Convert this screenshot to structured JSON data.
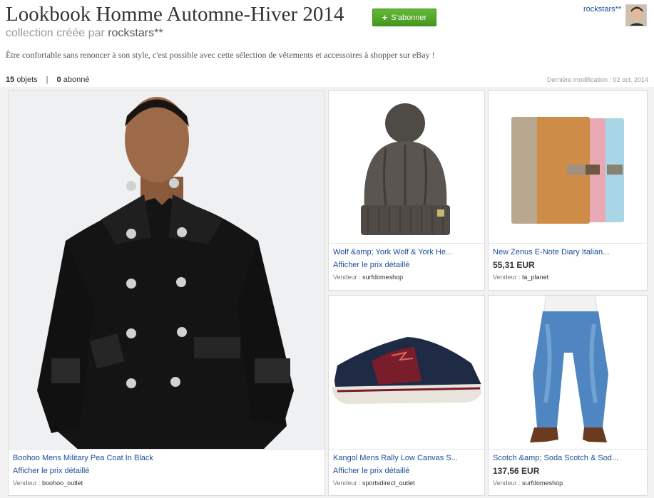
{
  "header": {
    "title": "Lookbook Homme Automne-Hiver 2014",
    "subscribe_label": "S'abonner",
    "byline_prefix": "collection créée par",
    "owner": "rockstars**",
    "user_link": "rockstars**",
    "description": "Être confortable sans renoncer à son style, c'est possible avec cette sélection de vêtements et accessoires à shopper sur eBay !"
  },
  "stats": {
    "count": "15",
    "count_label": "objets",
    "separator": "|",
    "followers": "0",
    "followers_label": "abonné",
    "modified_label": "Dernière modification :",
    "modified_date": "02 oct. 2014"
  },
  "items": [
    {
      "name": "Boohoo Mens Military Pea Coat In Black",
      "price_link": "Afficher le prix détaillé",
      "seller_label": "Vendeur :",
      "seller": "boohoo_outlet"
    },
    {
      "name": "Wolf &amp; York Wolf & York He...",
      "price_link": "Afficher le prix détaillé",
      "seller_label": "Vendeur :",
      "seller": "surfdomeshop"
    },
    {
      "name": "New Zenus E-Note Diary Italian...",
      "price": "55,31 EUR",
      "seller_label": "Vendeur :",
      "seller": "ta_planet"
    },
    {
      "name": "Kangol Mens Rally Low Canvas S...",
      "price_link": "Afficher le prix détaillé",
      "seller_label": "Vendeur :",
      "seller": "sportsdirect_outlet"
    },
    {
      "name": "Scotch &amp; Soda Scotch & Sod...",
      "price": "137,56 EUR",
      "seller_label": "Vendeur :",
      "seller": "surfdomeshop"
    }
  ],
  "colors": {
    "link": "#1a4e9a",
    "button_green": "#4fa626",
    "grid_bg": "#f2f2f2"
  }
}
